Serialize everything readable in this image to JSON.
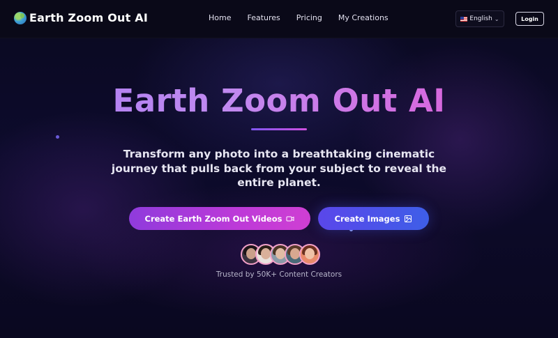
{
  "nav": {
    "brand": "Earth Zoom Out AI",
    "links": [
      "Home",
      "Features",
      "Pricing",
      "My Creations"
    ],
    "language": "English",
    "login": "Login"
  },
  "hero": {
    "title": "Earth Zoom Out AI",
    "subtitle": "Transform any photo into a breathtaking cinematic journey that pulls back from your subject to reveal the entire planet.",
    "primary_button": "Create Earth Zoom Out Videos",
    "secondary_button": "Create Images",
    "trusted_text": "Trusted by 50K+ Content Creators"
  },
  "icons": {
    "brand": "globe-icon",
    "language": "us-flag-icon",
    "primary_button": "video-camera-icon",
    "secondary_button": "image-icon"
  },
  "colors": {
    "background": "#07061a",
    "title_gradient_start": "#a97bf2",
    "title_gradient_end": "#e35bd6",
    "primary_button": "#b53ad8",
    "secondary_button": "#4a54e9"
  }
}
